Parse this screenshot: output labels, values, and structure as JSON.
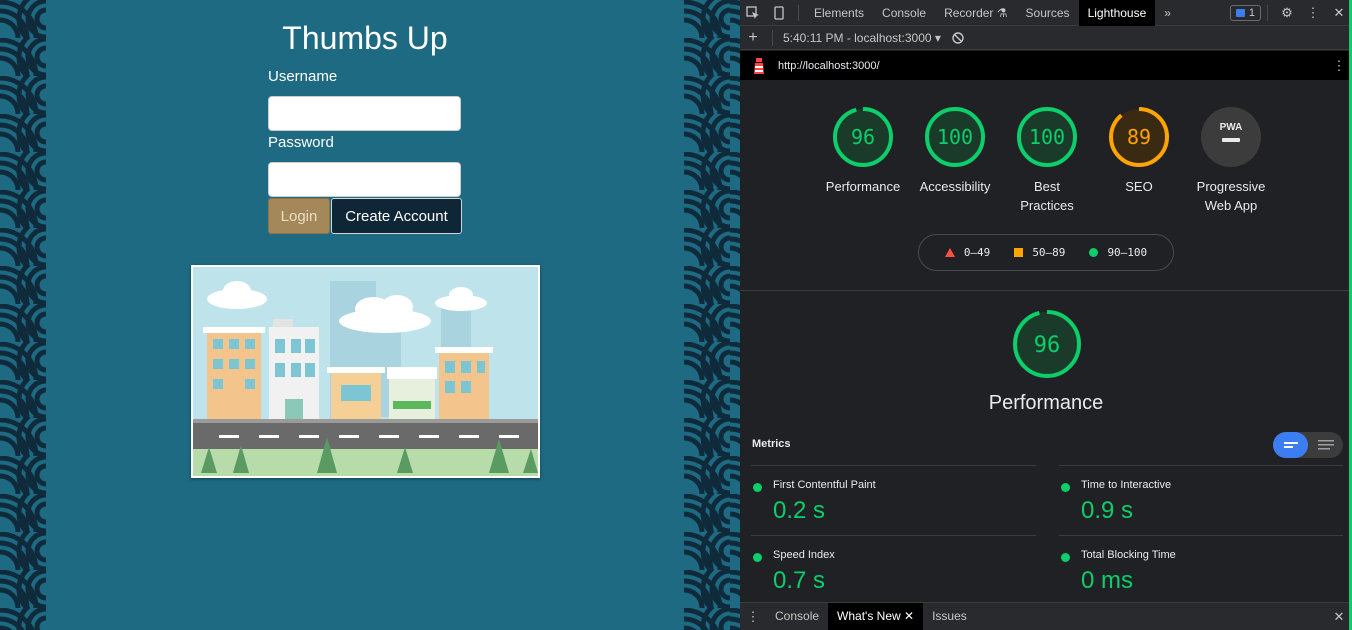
{
  "app": {
    "title": "Thumbs Up",
    "username_label": "Username",
    "username_value": "",
    "password_label": "Password",
    "password_value": "",
    "login_label": "Login",
    "create_label": "Create Account"
  },
  "devtools": {
    "tabs": [
      "Elements",
      "Console",
      "Recorder",
      "Sources",
      "Lighthouse"
    ],
    "active_tab": "Lighthouse",
    "more": "»",
    "issues_count": "1",
    "report_time": "5:40:11 PM - localhost:3000",
    "url": "http://localhost:3000/",
    "categories": [
      {
        "score": "96",
        "label": "Performance",
        "rating": "pass",
        "fraction": 0.96
      },
      {
        "score": "100",
        "label": "Accessibility",
        "rating": "pass",
        "fraction": 1.0
      },
      {
        "score": "100",
        "label": "Best Practices",
        "rating": "pass",
        "fraction": 1.0
      },
      {
        "score": "89",
        "label": "SEO",
        "rating": "average",
        "fraction": 0.89
      },
      {
        "score": "PWA",
        "label": "Progressive Web App",
        "rating": "na",
        "fraction": 0
      }
    ],
    "legend": {
      "fail": "0–49",
      "average": "50–89",
      "pass": "90–100"
    },
    "performance": {
      "score": "96",
      "fraction": 0.96,
      "title": "Performance",
      "metrics_label": "Metrics",
      "metrics": [
        {
          "name": "First Contentful Paint",
          "value": "0.2 s"
        },
        {
          "name": "Time to Interactive",
          "value": "0.9 s"
        },
        {
          "name": "Speed Index",
          "value": "0.7 s"
        },
        {
          "name": "Total Blocking Time",
          "value": "0 ms"
        }
      ]
    },
    "drawer_tabs": [
      "Console",
      "What's New",
      "Issues"
    ],
    "drawer_active": "What's New"
  },
  "colors": {
    "page_bg": "#1d6a82",
    "pattern_dark": "#0f2a3a",
    "pass": "#0cce6b",
    "average": "#ffa400",
    "fail": "#ff4e42",
    "accent": "#3c7ef1"
  }
}
